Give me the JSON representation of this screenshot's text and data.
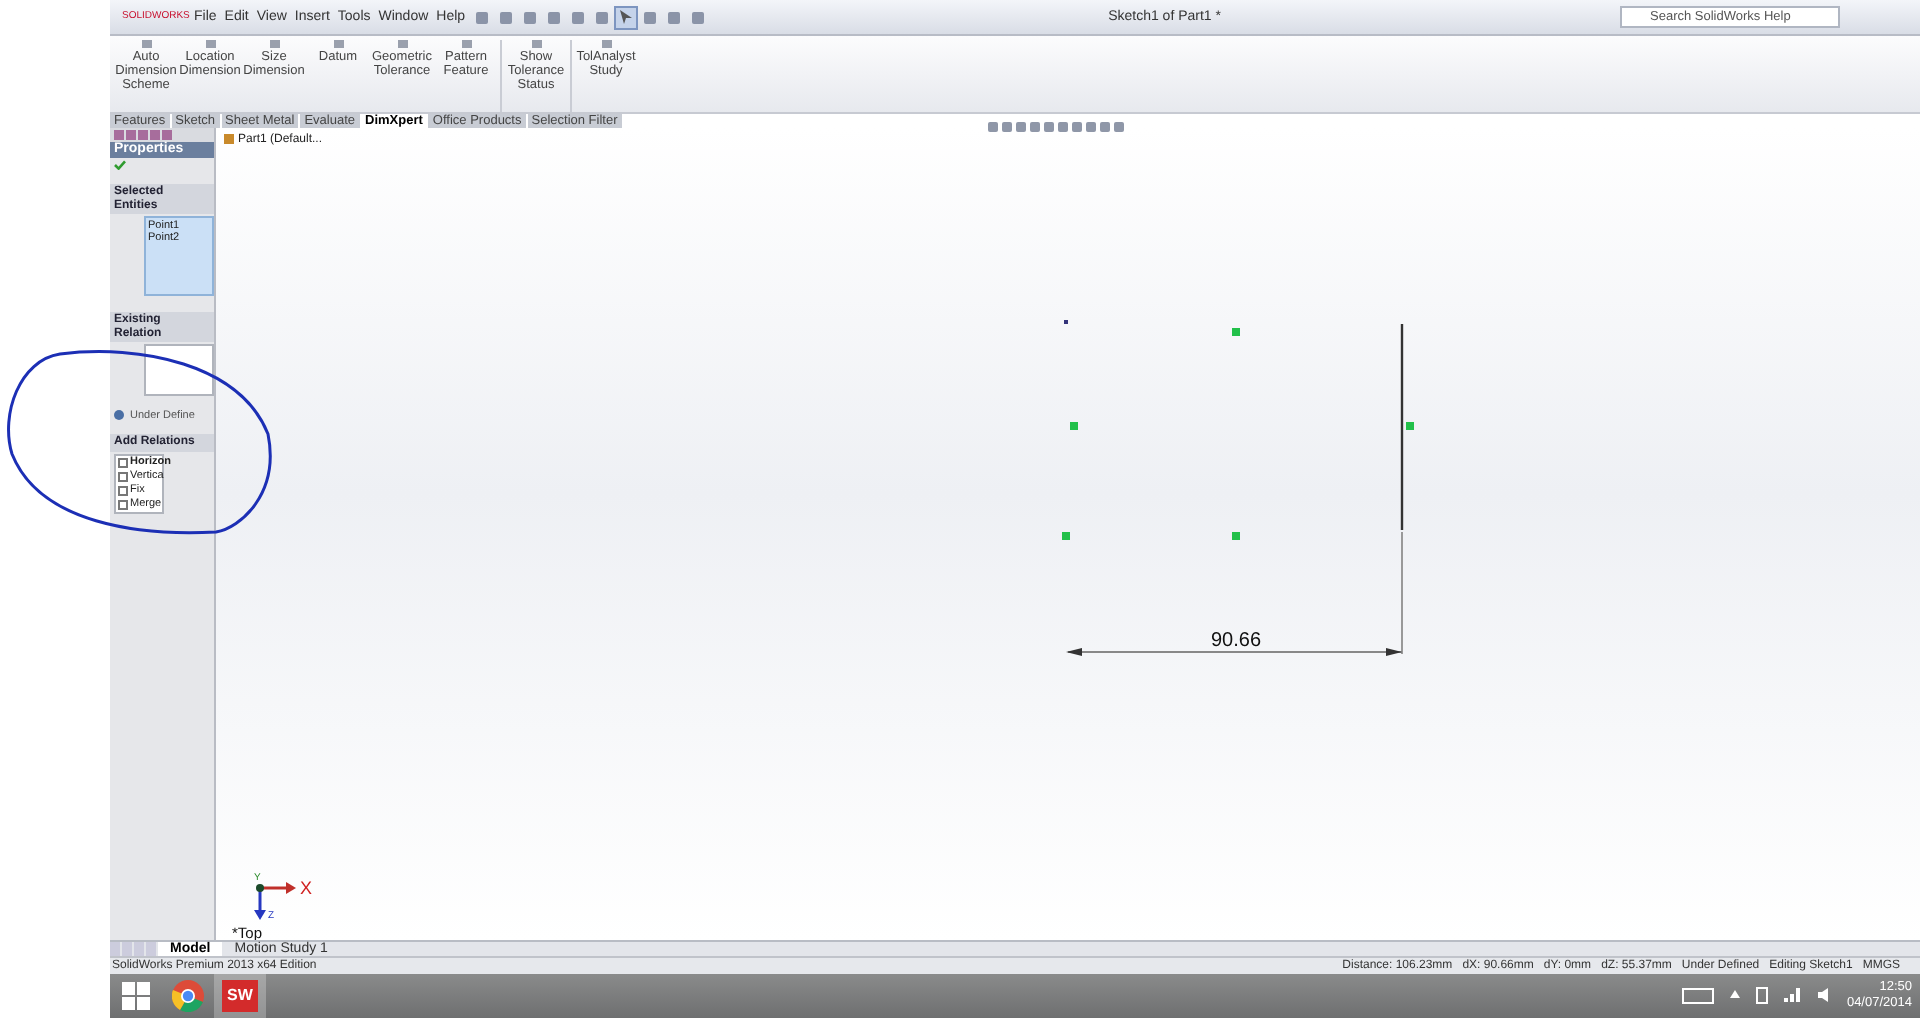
{
  "app": {
    "logo": "SOLIDWORKS",
    "menu": [
      "File",
      "Edit",
      "View",
      "Insert",
      "Tools",
      "Window",
      "Help"
    ],
    "title": "Sketch1 of Part1 *",
    "search": {
      "placeholder": "Search SolidWorks Help"
    }
  },
  "ribbon": [
    {
      "label": "Auto Dimension Scheme"
    },
    {
      "label": "Location Dimension"
    },
    {
      "label": "Size Dimension"
    },
    {
      "label": "Datum"
    },
    {
      "label": "Geometric Tolerance"
    },
    {
      "label": "Pattern Feature"
    },
    {
      "label": "Show Tolerance Status"
    },
    {
      "label": "TolAnalyst Study"
    }
  ],
  "command_tabs": [
    {
      "label": "Features",
      "selected": false
    },
    {
      "label": "Sketch",
      "selected": false
    },
    {
      "label": "Sheet Metal",
      "selected": false
    },
    {
      "label": "Evaluate",
      "selected": false
    },
    {
      "label": "DimXpert",
      "selected": true
    },
    {
      "label": "Office Products",
      "selected": false
    },
    {
      "label": "Selection Filter",
      "selected": false
    }
  ],
  "property_manager": {
    "title": "Properties",
    "selected_entities": {
      "heading": "Selected Entities",
      "items": [
        "Point1",
        "Point2"
      ]
    },
    "existing_relations": {
      "heading": "Existing Relation",
      "status": "Under Define"
    },
    "add_relations": {
      "heading": "Add Relations",
      "items": [
        "Horizon",
        "Vertica",
        "Fix",
        "Merge"
      ]
    }
  },
  "feature_tree": {
    "root": "Part1 (Default..."
  },
  "sketch": {
    "dimension": "90.66",
    "view_label": "*Top",
    "axes": [
      "X",
      "Y",
      "Z"
    ]
  },
  "bottom_tabs": [
    {
      "label": "Model",
      "selected": true
    },
    {
      "label": "Motion Study 1",
      "selected": false
    }
  ],
  "status_bar": {
    "edition": "SolidWorks Premium 2013 x64 Edition",
    "readouts": [
      "Distance: 106.23mm",
      "dX: 90.66mm",
      "dY: 0mm",
      "dZ: 55.37mm"
    ],
    "state": "Under Defined",
    "mode": "Editing Sketch1",
    "units": "MMGS"
  },
  "taskbar": {
    "app_label": "SW",
    "time": "12:50",
    "date": "04/07/2014"
  }
}
